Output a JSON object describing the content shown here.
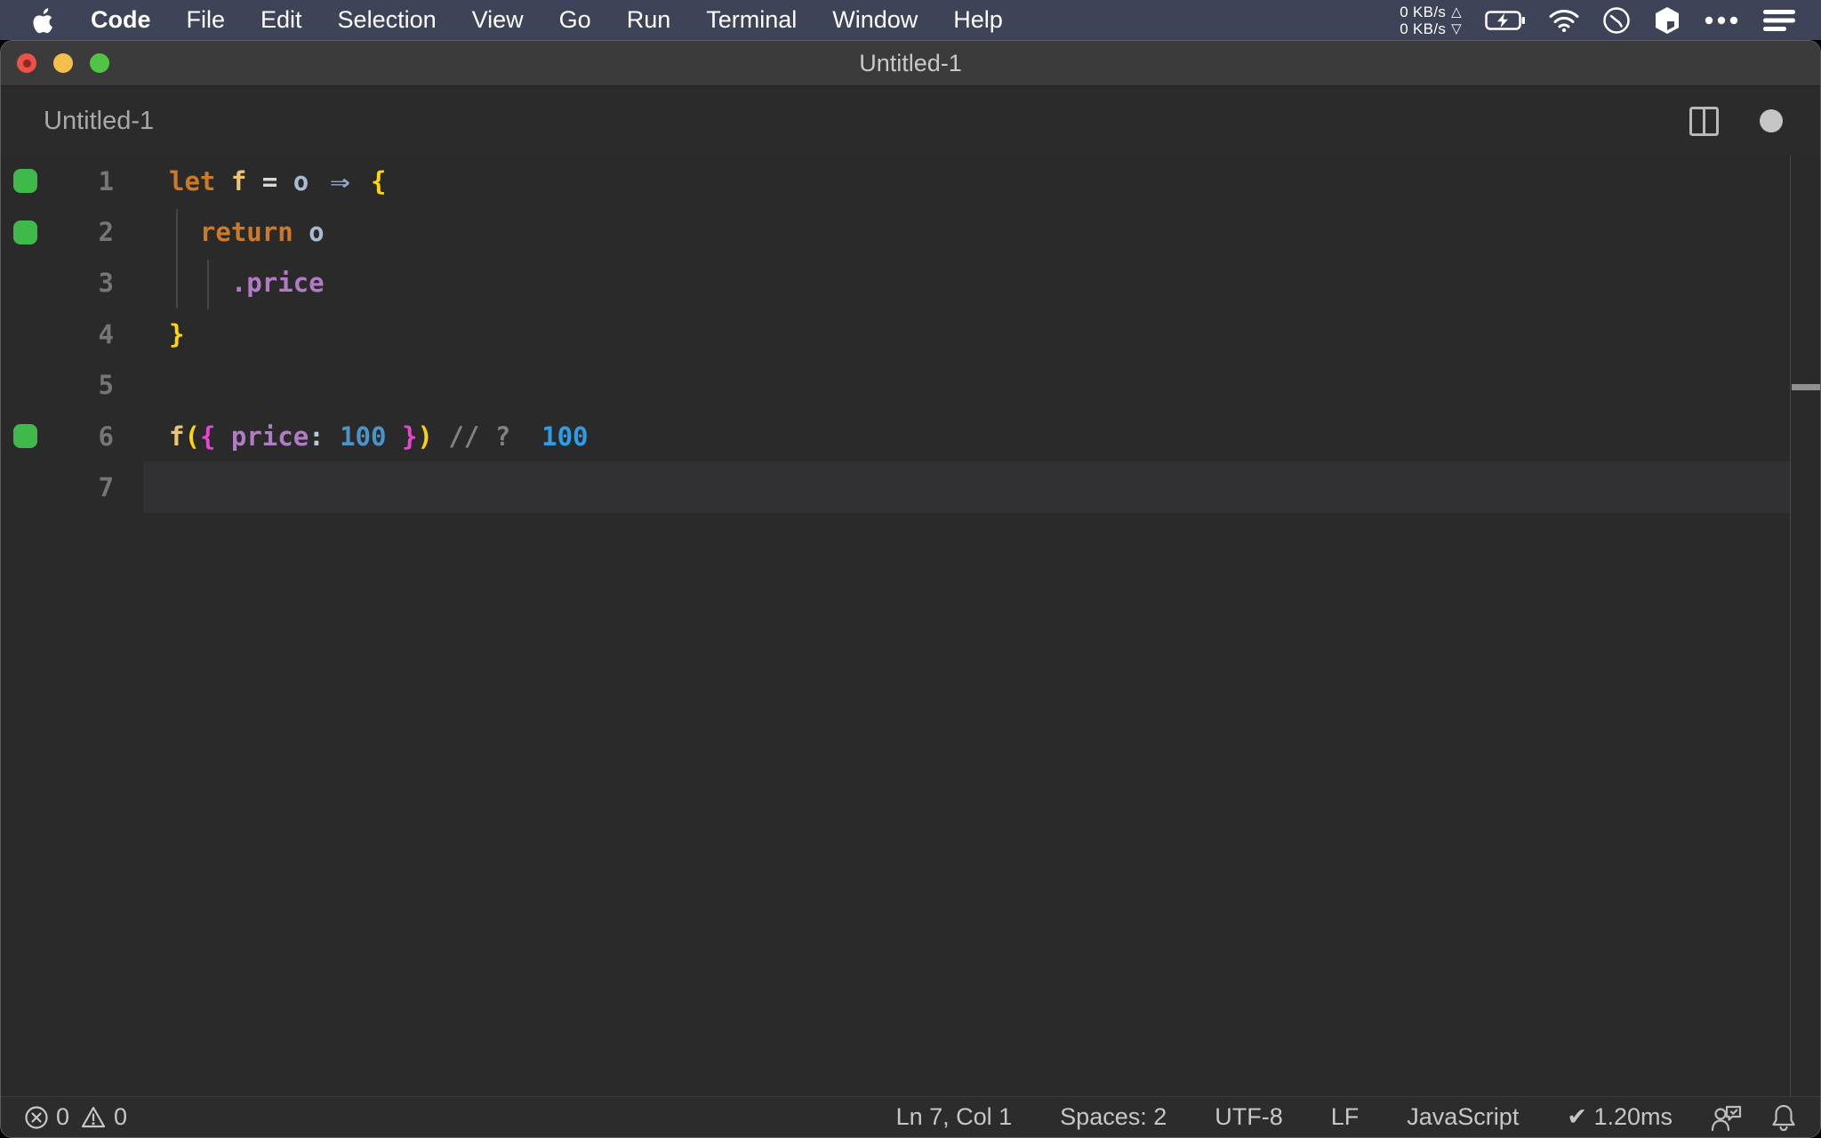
{
  "menubar": {
    "apple_icon": "apple-logo",
    "items": [
      {
        "label": "Code",
        "bold": true
      },
      {
        "label": "File"
      },
      {
        "label": "Edit"
      },
      {
        "label": "Selection"
      },
      {
        "label": "View"
      },
      {
        "label": "Go"
      },
      {
        "label": "Run"
      },
      {
        "label": "Terminal"
      },
      {
        "label": "Window"
      },
      {
        "label": "Help"
      }
    ],
    "net_up": "0 KB/s",
    "net_down": "0 KB/s",
    "net_up_glyph": "△",
    "net_down_glyph": "▽"
  },
  "window": {
    "title": "Untitled-1",
    "tab_label": "Untitled-1"
  },
  "editor": {
    "background": "#2a2a2b",
    "coverage_color": "#3fba4a",
    "token_colors": {
      "plain": "#d4d4d4",
      "keyword": "#cd7928",
      "fname": "#f0c373",
      "operator": "#d6dade",
      "variable": "#a7bcd4",
      "arrow": "#90a9c8",
      "brace1": "#ffd702",
      "paren": "#ffd400",
      "brace2": "#ee41d8",
      "property": "#b17cc5",
      "colon": "#b9cbd8",
      "number": "#4a95c8",
      "comment": "#828282",
      "result": "#2d9de8"
    },
    "lines": [
      {
        "num": "1",
        "marker": true,
        "tokens": [
          {
            "text": "let ",
            "style": "keyword"
          },
          {
            "text": "f",
            "style": "fname"
          },
          {
            "text": " ",
            "style": "plain"
          },
          {
            "text": "=",
            "style": "operator"
          },
          {
            "text": " ",
            "style": "plain"
          },
          {
            "text": "o",
            "style": "variable"
          },
          {
            "text": " ",
            "style": "plain"
          },
          {
            "text": "⇒",
            "style": "arrow"
          },
          {
            "text": " ",
            "style": "plain"
          },
          {
            "text": "{",
            "style": "brace1"
          }
        ]
      },
      {
        "num": "2",
        "marker": true,
        "tokens": [
          {
            "text": "  ",
            "style": "plain"
          },
          {
            "text": "return",
            "style": "keyword"
          },
          {
            "text": " ",
            "style": "plain"
          },
          {
            "text": "o",
            "style": "variable"
          }
        ]
      },
      {
        "num": "3",
        "tokens": [
          {
            "text": "    ",
            "style": "plain"
          },
          {
            "text": ".price",
            "style": "property"
          }
        ]
      },
      {
        "num": "4",
        "tokens": [
          {
            "text": "}",
            "style": "brace1"
          }
        ]
      },
      {
        "num": "5",
        "tokens": []
      },
      {
        "num": "6",
        "marker": true,
        "tokens": [
          {
            "text": "f",
            "style": "fname"
          },
          {
            "text": "(",
            "style": "paren"
          },
          {
            "text": "{",
            "style": "brace2"
          },
          {
            "text": " price",
            "style": "property"
          },
          {
            "text": ":",
            "style": "colon"
          },
          {
            "text": " 100",
            "style": "number"
          },
          {
            "text": " }",
            "style": "brace2"
          },
          {
            "text": ")",
            "style": "paren"
          },
          {
            "text": " // ?",
            "style": "comment"
          },
          {
            "text": "  100",
            "style": "result"
          }
        ]
      },
      {
        "num": "7",
        "current": true,
        "tokens": []
      }
    ]
  },
  "statusbar": {
    "errors": "0",
    "warnings": "0",
    "right_items": [
      {
        "name": "cursor-position",
        "label": "Ln 7, Col 1"
      },
      {
        "name": "indentation",
        "label": "Spaces: 2"
      },
      {
        "name": "encoding",
        "label": "UTF-8"
      },
      {
        "name": "eol",
        "label": "LF"
      },
      {
        "name": "language-mode",
        "label": "JavaScript"
      },
      {
        "name": "quokka-time",
        "label": "✔ 1.20ms"
      }
    ]
  }
}
